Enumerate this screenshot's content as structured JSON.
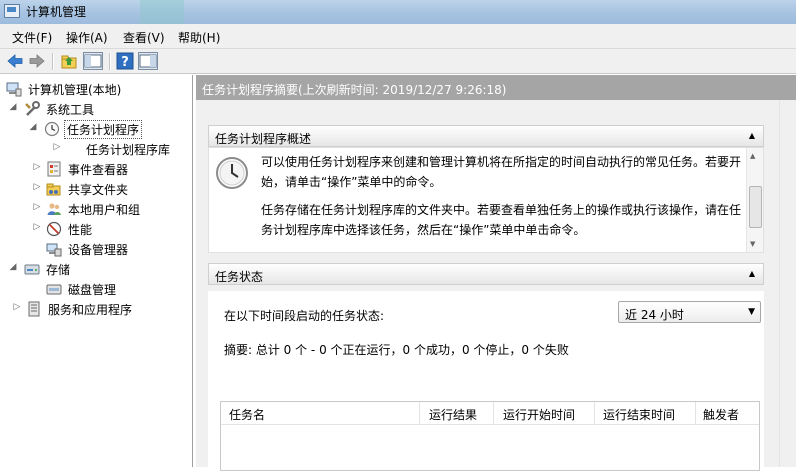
{
  "window": {
    "title": "计算机管理"
  },
  "menu": {
    "file": "文件(F)",
    "action": "操作(A)",
    "view": "查看(V)",
    "help": "帮助(H)"
  },
  "tree": {
    "root": "计算机管理(本地)",
    "system_tools": "系统工具",
    "task_scheduler": "任务计划程序",
    "task_library": "任务计划程序库",
    "event_viewer": "事件查看器",
    "shared_folders": "共享文件夹",
    "local_users": "本地用户和组",
    "performance": "性能",
    "device_manager": "设备管理器",
    "storage": "存储",
    "disk_management": "磁盘管理",
    "services_apps": "服务和应用程序"
  },
  "right": {
    "header": "任务计划程序摘要(上次刷新时间: 2019/12/27 9:26:18)",
    "overview": {
      "title": "任务计划程序概述",
      "p1": "可以使用任务计划程序来创建和管理计算机将在所指定的时间自动执行的常见任务。若要开始，请单击“操作”菜单中的命令。",
      "p2": "任务存储在任务计划程序库的文件夹中。若要查看单独任务上的操作或执行该操作，请在任务计划程序库中选择该任务，然后在“操作”菜单中单击命令。"
    },
    "status": {
      "title": "任务状态",
      "label": "在以下时间段启动的任务状态:",
      "range": "近 24 小时",
      "summary": "摘要: 总计 0 个 - 0 个正在运行，0 个成功，0 个停止，0 个失败",
      "columns": [
        "任务名",
        "运行结果",
        "运行开始时间",
        "运行结束时间",
        "触发者"
      ]
    }
  },
  "colors": {
    "title_bar": "#a8c4e2",
    "header_bar": "#a5a5a5",
    "selection_dotted": "#555555"
  }
}
